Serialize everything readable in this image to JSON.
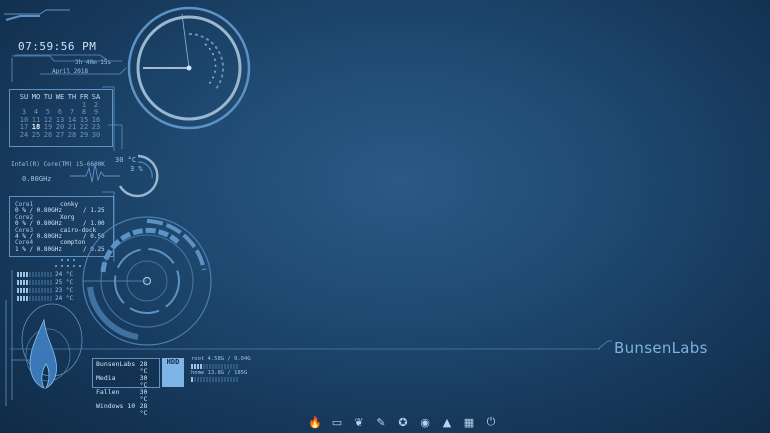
{
  "clock": {
    "time": "07:59:56 PM",
    "uptime": "3h 40m 15s",
    "date": "April 2018"
  },
  "calendar": {
    "weekdays": [
      "SU",
      "MO",
      "TU",
      "WE",
      "TH",
      "FR",
      "SA"
    ],
    "weeks": [
      [
        "",
        "",
        "",
        "",
        "",
        "1",
        "2"
      ],
      [
        "3",
        "4",
        "5",
        "6",
        "7",
        "8",
        "9"
      ],
      [
        "10",
        "11",
        "12",
        "13",
        "14",
        "15",
        "16"
      ],
      [
        "17",
        "18",
        "19",
        "20",
        "21",
        "22",
        "23"
      ],
      [
        "24",
        "25",
        "26",
        "27",
        "28",
        "29",
        "30"
      ]
    ],
    "today": "18"
  },
  "cpu": {
    "model": "Intel(R) Core(TM) i5-6600K",
    "freq": "0.80GHz",
    "temp": "30 °C",
    "usage": "3 %",
    "cores": [
      {
        "label": "Core1",
        "value": "0 % / 0.80GHz",
        "process": "conky",
        "load": "/ 1.25"
      },
      {
        "label": "Core2",
        "value": "0 % / 0.80GHz",
        "process": "Xorg",
        "load": "/ 1.00"
      },
      {
        "label": "Core3",
        "value": "4 % / 0.80GHz",
        "process": "cairo-dock",
        "load": "/ 0.50"
      },
      {
        "label": "Core4",
        "value": "1 % / 0.80GHz",
        "process": "compton",
        "load": "/ 0.25"
      }
    ]
  },
  "temps": [
    {
      "value": "24 °C",
      "fill": 0.35
    },
    {
      "value": "25 °C",
      "fill": 0.35
    },
    {
      "value": "23 °C",
      "fill": 0.3
    },
    {
      "value": "24 °C",
      "fill": 0.35
    }
  ],
  "hdd": {
    "label": "HDD",
    "drives": [
      {
        "name": "BunsenLabs",
        "temp": "28 °C"
      },
      {
        "name": "Media",
        "temp": "30 °C"
      },
      {
        "name": "Fallen",
        "temp": "30 °C"
      },
      {
        "name": "Windows 10",
        "temp": "28 °C"
      }
    ]
  },
  "net": {
    "line1": "root  4.58G / 9.04G",
    "line2": "home  13.8G / 185G"
  },
  "brand": "BunsenLabs",
  "dock": {
    "icons": [
      "flame-icon",
      "terminal-icon",
      "file-manager-icon",
      "editor-icon",
      "settings-icon",
      "browser-icon",
      "launcher-icon",
      "calculator-icon",
      "power-icon"
    ],
    "glyphs": [
      "🔥",
      "▭",
      "❦",
      "✎",
      "✪",
      "◉",
      "▲",
      "▦",
      "⏻"
    ]
  },
  "colors": {
    "accent": "#5d93c4",
    "text": "#9ec4e4",
    "bright": "#cfe4f7",
    "bg": "#1f4a72"
  }
}
